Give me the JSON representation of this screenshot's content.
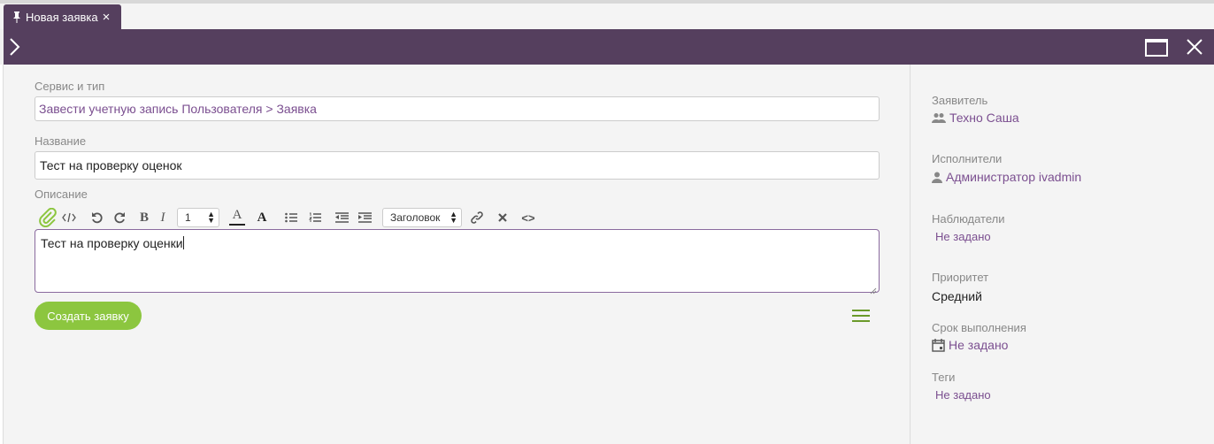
{
  "tab": {
    "title": "Новая заявка",
    "close": "×"
  },
  "form": {
    "service_label": "Сервис и тип",
    "service_value": "Завести учетную запись Пользователя > Заявка",
    "name_label": "Название",
    "name_value": "Тест на проверку оценок",
    "description_label": "Описание",
    "description_value": "Тест на проверку оценки",
    "submit_label": "Создать заявку"
  },
  "toolbar": {
    "bold": "B",
    "italic": "I",
    "font_size": "1",
    "font_color": "A",
    "bg_color": "A",
    "heading": "Заголовок",
    "code": "<>"
  },
  "sidebar": {
    "requester_label": "Заявитель",
    "requester_value": "Техно Саша",
    "executors_label": "Исполнители",
    "executors_value": "Администратор ivadmin",
    "watchers_label": "Наблюдатели",
    "watchers_value": "Не задано",
    "priority_label": "Приоритет",
    "priority_value": "Средний",
    "deadline_label": "Срок выполнения",
    "deadline_value": "Не задано",
    "tags_label": "Теги",
    "tags_value": "Не задано"
  },
  "colors": {
    "header": "#553f5e",
    "accent_link": "#7b4f90",
    "submit": "#8cc63f",
    "menu_icon": "#6a9a2a"
  }
}
